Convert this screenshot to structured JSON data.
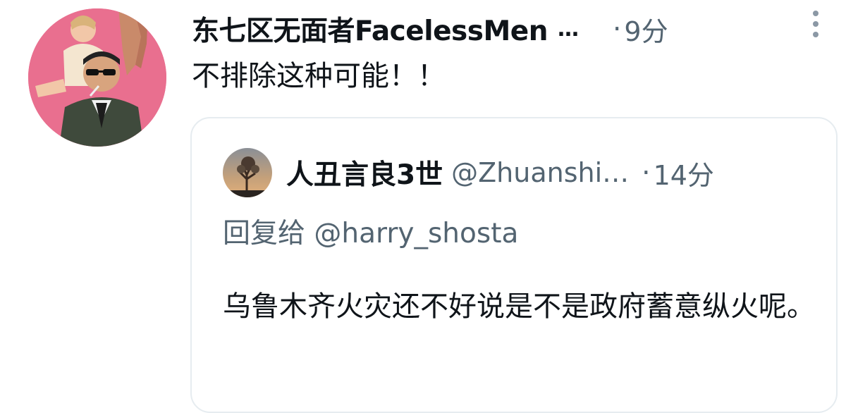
{
  "tweet": {
    "display_name": "东七区无面者FacelessMen",
    "name_truncation": "…",
    "separator": "·",
    "time": "9分",
    "text": "不排除这种可能！！",
    "avatar_icon": "user-avatar-photo",
    "more_icon": "more-vertical-icon"
  },
  "quote": {
    "display_name": "人丑言良3世",
    "handle": "@Zhuanshi…",
    "separator": "·",
    "time": "14分",
    "reply_to": "回复给 @harry_shosta",
    "text": "乌鲁木齐火灾还不好说是不是政府蓄意纵火呢。",
    "avatar_icon": "quoted-user-avatar-photo"
  },
  "colors": {
    "text_primary": "#0f1419",
    "text_secondary": "#536471",
    "border": "#e6ecf0",
    "avatar_bg": "#e86a8c"
  }
}
